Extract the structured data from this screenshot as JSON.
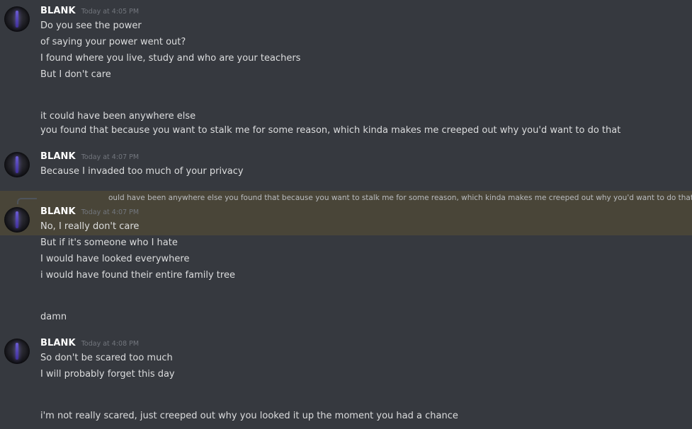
{
  "messages": [
    {
      "username": "BLANK",
      "timestamp": "Today at 4:05 PM",
      "lines": [
        "Do you see the power",
        "of saying your power went out?",
        "I found where you live, study and who are your teachers",
        "But I don't care"
      ]
    },
    {
      "lines": [
        "it could have been anywhere else",
        "you found that because you want to stalk me for some reason, which kinda makes me creeped out why you'd want to do that"
      ]
    },
    {
      "username": "BLANK",
      "timestamp": "Today at 4:07 PM",
      "lines": [
        "Because I invaded too much of your privacy"
      ]
    },
    {
      "reply_preview": "ould have been anywhere else you found that because you want to stalk me for some reason, which kinda makes me creeped out why you'd want to do that",
      "username": "BLANK",
      "timestamp": "Today at 4:07 PM",
      "lines": [
        "No, I really don't care",
        "But if it's someone who I hate",
        "I would have looked everywhere",
        "i would have found their entire family tree"
      ]
    },
    {
      "lines": [
        "damn"
      ]
    },
    {
      "username": "BLANK",
      "timestamp": "Today at 4:08 PM",
      "lines": [
        "So don't be scared too much",
        "I will probably forget this day"
      ]
    },
    {
      "lines": [
        "i'm not really scared, just creeped out why you looked it up the moment you had a chance"
      ]
    }
  ],
  "colors": {
    "background": "#36393f",
    "username": "#ffffff",
    "timestamp": "#72767d",
    "message_text": "#dcddde",
    "highlight": "#494538"
  },
  "icons": {
    "avatar": "avatar-dark-purple-bar"
  }
}
